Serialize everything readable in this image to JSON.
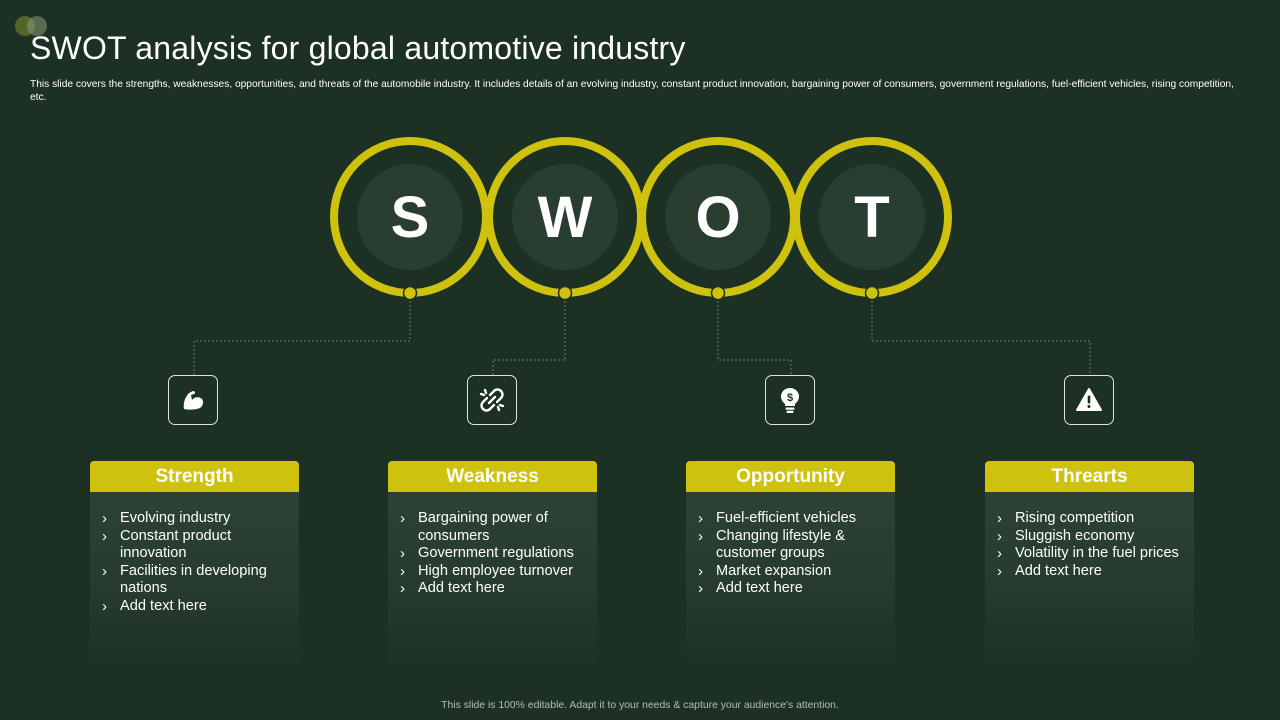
{
  "slide": {
    "title": "SWOT analysis for global automotive industry",
    "subtitle": "This slide covers the strengths, weaknesses, opportunities, and threats of the automobile  industry. It includes details of an evolving industry, constant product innovation, bargaining power of consumers, government regulations, fuel-efficient vehicles, rising competition,  etc.",
    "footer": "This slide is 100% editable.  Adapt it to your needs & capture your audience's attention."
  },
  "colors": {
    "background": "#1c3024",
    "accent": "#cfc20f",
    "ring_inner": "#2a3d31",
    "connector": "#6f7d70"
  },
  "quadrants": [
    {
      "letter": "S",
      "icon": "flexed-arm-icon",
      "label": "Strength",
      "items": [
        "Evolving industry",
        "Constant product innovation",
        "Facilities in developing nations",
        "Add text here"
      ]
    },
    {
      "letter": "W",
      "icon": "broken-link-icon",
      "label": "Weakness",
      "items": [
        "Bargaining power of consumers",
        "Government regulations",
        "High employee turnover",
        "Add text here"
      ]
    },
    {
      "letter": "O",
      "icon": "lightbulb-dollar-icon",
      "label": "Opportunity",
      "items": [
        "Fuel-efficient vehicles",
        "Changing lifestyle & customer groups",
        "Market expansion",
        "Add text here"
      ]
    },
    {
      "letter": "T",
      "icon": "warning-triangle-icon",
      "label": "Threarts",
      "items": [
        "Rising competition",
        "Sluggish economy",
        "Volatility  in the fuel prices",
        "Add text here"
      ]
    }
  ]
}
